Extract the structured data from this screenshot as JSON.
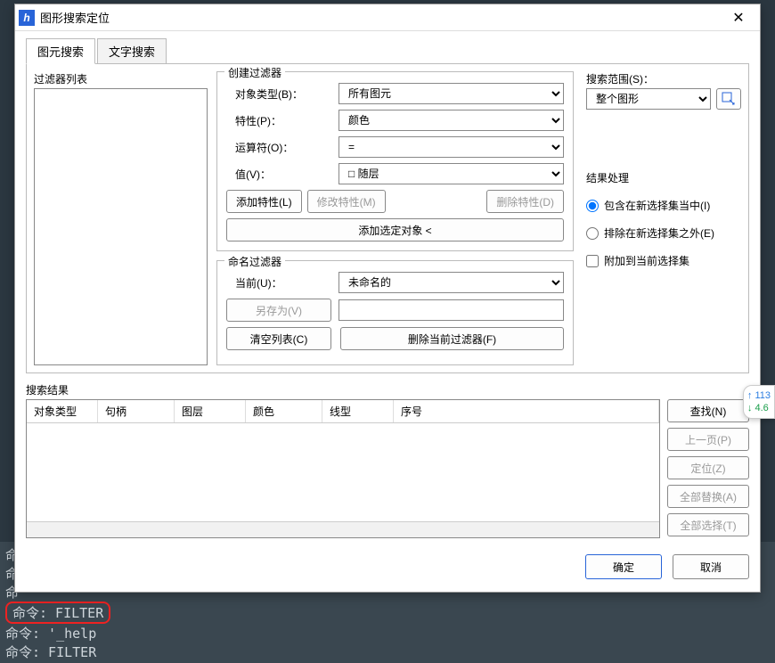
{
  "title": "图形搜索定位",
  "tabs": {
    "primitive": "图元搜索",
    "text": "文字搜索"
  },
  "filter_list_label": "过滤器列表",
  "create_filter": {
    "group_title": "创建过滤器",
    "obj_type_label": "对象类型(B)：",
    "obj_type_value": "所有图元",
    "prop_label": "特性(P)：",
    "prop_value": "颜色",
    "op_label": "运算符(O)：",
    "op_value": "=",
    "value_label": "值(V)：",
    "value_value": "随层",
    "add_prop": "添加特性(L)",
    "modify_prop": "修改特性(M)",
    "delete_prop": "删除特性(D)",
    "add_selected": "添加选定对象 <"
  },
  "named_filter": {
    "group_title": "命名过滤器",
    "current_label": "当前(U)：",
    "current_value": "未命名的",
    "save_as": "另存为(V)",
    "clear_list": "清空列表(C)",
    "delete_current": "删除当前过滤器(F)"
  },
  "scope": {
    "label": "搜索范围(S)：",
    "value": "整个图形"
  },
  "result_process": {
    "group_title": "结果处理",
    "include": "包含在新选择集当中(I)",
    "exclude": "排除在新选择集之外(E)",
    "append": "附加到当前选择集"
  },
  "results": {
    "label": "搜索结果",
    "cols": {
      "obj_type": "对象类型",
      "handle": "句柄",
      "layer": "图层",
      "color": "颜色",
      "linetype": "线型",
      "index": "序号"
    }
  },
  "side_buttons": {
    "find": "查找(N)",
    "prev": "上一页(P)",
    "locate": "定位(Z)",
    "replace_all": "全部替换(A)",
    "select_all": "全部选择(T)"
  },
  "footer": {
    "ok": "确定",
    "cancel": "取消"
  },
  "console": {
    "l1": "命",
    "l2": "命",
    "l3": "命",
    "l4_pref": "命令: ",
    "l4": "FILTER",
    "l5": "命令: '_help",
    "l6": "命令: FILTER"
  },
  "floating": {
    "up": "↑ 113",
    "dn": "↓ 4.6"
  }
}
